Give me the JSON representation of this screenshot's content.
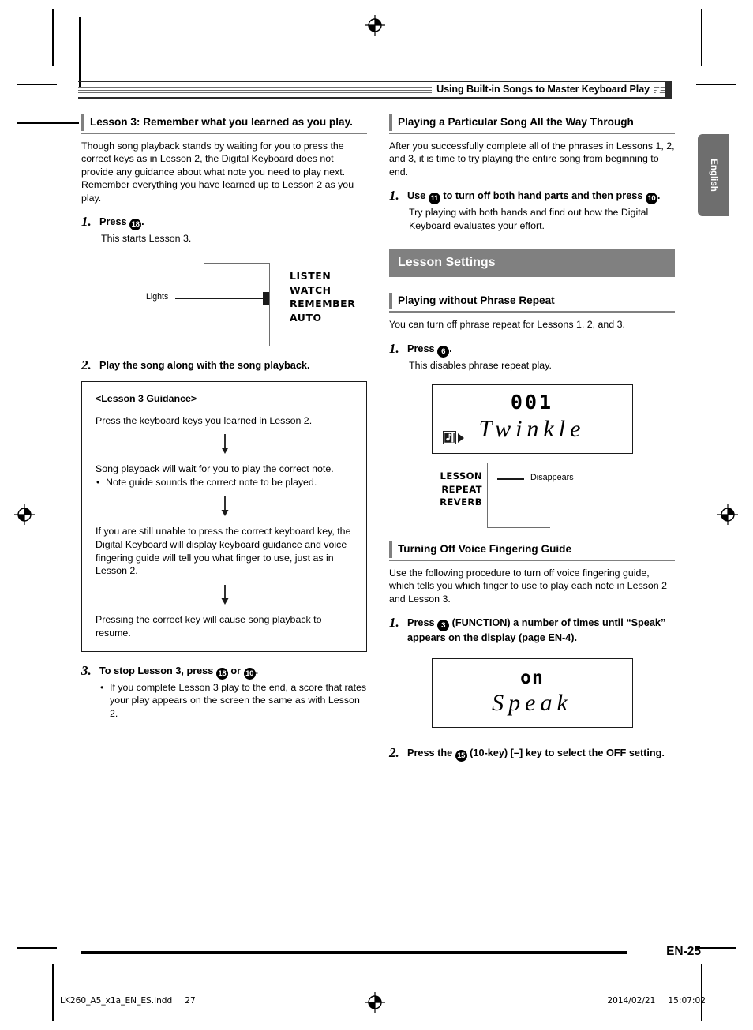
{
  "header": {
    "title": "Using Built-in Songs to Master Keyboard Play",
    "side_tab": "English"
  },
  "left_column": {
    "heading": "Lesson 3: Remember what you learned as you play.",
    "intro": "Though song playback stands by waiting for you to press the correct keys as in Lesson 2, the Digital Keyboard does not provide any guidance about what note you need to play next. Remember everything you have learned up to Lesson 2 as you play.",
    "step1": {
      "num": "1.",
      "title_pre": "Press",
      "title_badge": "18",
      "title_post": ".",
      "desc": "This starts Lesson 3."
    },
    "lights_figure": {
      "label": "Lights",
      "modes": [
        "LISTEN",
        "WATCH",
        "REMEMBER",
        "AUTO"
      ]
    },
    "step2": {
      "num": "2.",
      "title": "Play the song along with the song playback."
    },
    "guidance": {
      "title": "<Lesson 3 Guidance>",
      "block1": "Press the keyboard keys you learned in Lesson 2.",
      "block2": "Song playback will wait for you to play the correct note.",
      "block2_bullet": "Note guide sounds the correct note to be played.",
      "block3": "If you are still unable to press the correct keyboard key, the Digital Keyboard will display keyboard guidance and voice fingering guide will tell you what finger to use, just as in Lesson 2.",
      "block4": "Pressing the correct key will cause song playback to resume."
    },
    "step3": {
      "num": "3.",
      "title_pre": "To stop Lesson 3, press",
      "title_badge_1": "18",
      "title_mid": "or",
      "title_badge_2": "10",
      "title_post": ".",
      "bullet": "If you complete Lesson 3 play to the end, a score that rates your play appears on the screen the same as with Lesson 2."
    }
  },
  "right_column": {
    "section1": {
      "heading": "Playing a Particular Song All the Way Through",
      "intro": "After you successfully complete all of the phrases in Lessons 1, 2, and 3, it is time to try playing the entire song from beginning to end.",
      "step1": {
        "num": "1.",
        "title_pre": "Use",
        "title_badge_1": "11",
        "title_mid": "to turn off both hand parts and then press",
        "title_badge_2": "10",
        "title_post": ".",
        "desc": "Try playing with both hands and find out how the Digital Keyboard evaluates your effort."
      }
    },
    "banner": "Lesson Settings",
    "section2": {
      "heading": "Playing without Phrase Repeat",
      "intro": "You can turn off phrase repeat for Lessons 1, 2, and 3.",
      "step1": {
        "num": "1.",
        "title_pre": "Press",
        "title_badge": "6",
        "title_post": ".",
        "desc": "This disables phrase repeat play."
      },
      "lcd": {
        "number": "001",
        "song_name": "Twinkle",
        "icon": "song-note-icon",
        "play_icon": "play-triangle-icon"
      },
      "disappears_figure": {
        "modes": [
          "LESSON",
          "REPEAT",
          "REVERB"
        ],
        "label": "Disappears"
      }
    },
    "section3": {
      "heading": "Turning Off Voice Fingering Guide",
      "intro": "Use the following procedure to turn off voice fingering guide, which tells you which finger to use to play each note in Lesson 2 and Lesson 3.",
      "step1": {
        "num": "1.",
        "title_pre": "Press",
        "title_badge": "3",
        "title_post": " (FUNCTION) a number of times until “Speak” appears on the display (page EN-4)."
      },
      "lcd": {
        "state": "on",
        "word": "Speak"
      },
      "step2": {
        "num": "2.",
        "title_pre": "Press the",
        "title_badge": "15",
        "title_post": " (10-key) [–] key to select the OFF setting."
      }
    }
  },
  "footer": {
    "page_label": "EN-25",
    "print_file": "LK260_A5_x1a_EN_ES.indd",
    "print_page": "27",
    "print_date": "2014/02/21",
    "print_time": "15:07:02"
  },
  "colors": {
    "gray_accent": "#808080",
    "dark": "#1a1a1a",
    "tab_gray": "#6e6e6e"
  }
}
